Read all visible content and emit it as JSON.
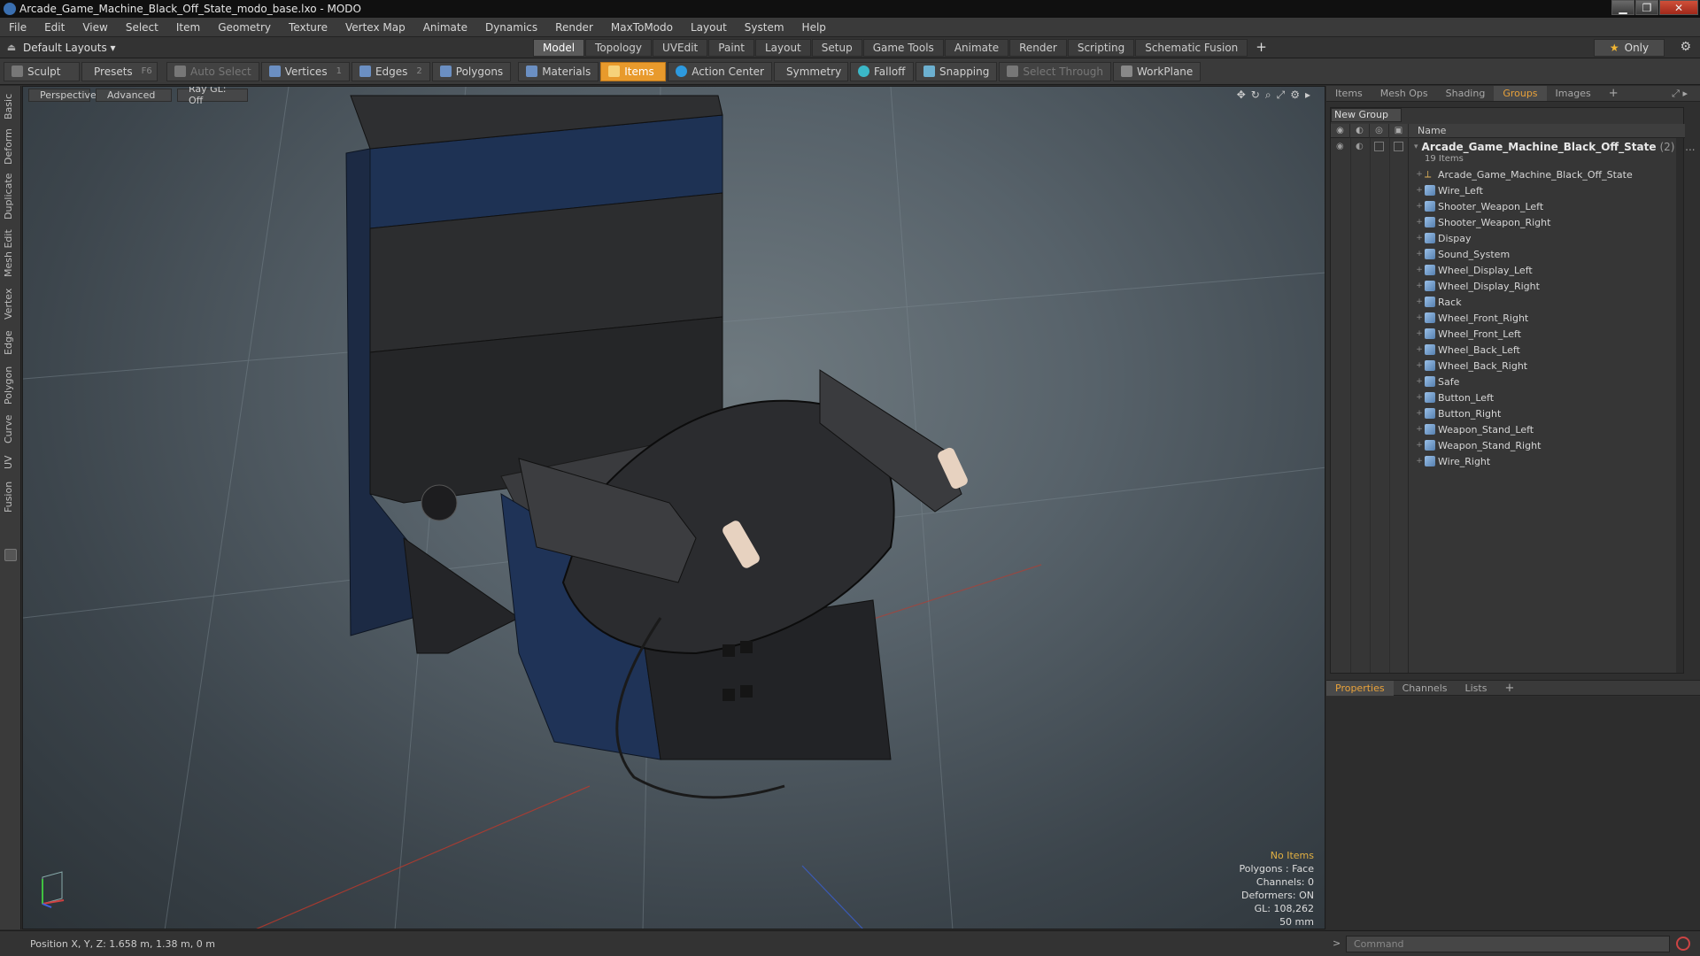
{
  "window": {
    "title": "Arcade_Game_Machine_Black_Off_State_modo_base.lxo - MODO",
    "minimize": "▁",
    "restore": "❐",
    "close": "✕"
  },
  "menu": [
    "File",
    "Edit",
    "View",
    "Select",
    "Item",
    "Geometry",
    "Texture",
    "Vertex Map",
    "Animate",
    "Dynamics",
    "Render",
    "MaxToModo",
    "Layout",
    "System",
    "Help"
  ],
  "layoutbar": {
    "layouts_label": "Default Layouts ▾",
    "tabs": [
      "Model",
      "Topology",
      "UVEdit",
      "Paint",
      "Layout",
      "Setup",
      "Game Tools",
      "Animate",
      "Render",
      "Scripting",
      "Schematic Fusion"
    ],
    "active_tab": "Model",
    "plus": "+",
    "only_label": "Only"
  },
  "toolbar": {
    "sculpt": "Sculpt",
    "presets": "Presets",
    "presets_key": "F6",
    "auto_select": "Auto Select",
    "vertices": "Vertices",
    "vertices_key": "1",
    "edges": "Edges",
    "edges_key": "2",
    "polygons": "Polygons",
    "materials": "Materials",
    "items": "Items",
    "action_center": "Action Center",
    "symmetry": "Symmetry",
    "falloff": "Falloff",
    "snapping": "Snapping",
    "select_through": "Select Through",
    "workplane": "WorkPlane"
  },
  "left_tabs": [
    "Basic",
    "Deform",
    "Duplicate",
    "Mesh Edit",
    "Vertex",
    "Edge",
    "Polygon",
    "Curve",
    "UV",
    "Fusion"
  ],
  "viewport": {
    "view": "Perspective",
    "shading": "Advanced",
    "raygl": "Ray GL: Off",
    "info": {
      "selection": "No Items",
      "polygons": "Polygons : Face",
      "channels": "Channels: 0",
      "deformers": "Deformers: ON",
      "gl": "GL: 108,262",
      "scale": "50 mm"
    }
  },
  "right_panel": {
    "tabs": [
      "Items",
      "Mesh Ops",
      "Shading",
      "Groups",
      "Images"
    ],
    "active_tab": "Groups",
    "new_group": "New Group",
    "column_name": "Name",
    "root": {
      "name": "Arcade_Game_Machine_Black_Off_State",
      "count": "(2) : ...",
      "sub": "19 Items"
    },
    "items": [
      {
        "name": "Arcade_Game_Machine_Black_Off_State",
        "icon": "locator-icon"
      },
      {
        "name": "Wire_Left",
        "icon": "mesh-icon"
      },
      {
        "name": "Shooter_Weapon_Left",
        "icon": "mesh-icon"
      },
      {
        "name": "Shooter_Weapon_Right",
        "icon": "mesh-icon"
      },
      {
        "name": "Dispay",
        "icon": "mesh-icon"
      },
      {
        "name": "Sound_System",
        "icon": "mesh-icon"
      },
      {
        "name": "Wheel_Display_Left",
        "icon": "mesh-icon"
      },
      {
        "name": "Wheel_Display_Right",
        "icon": "mesh-icon"
      },
      {
        "name": "Rack",
        "icon": "mesh-icon"
      },
      {
        "name": "Wheel_Front_Right",
        "icon": "mesh-icon"
      },
      {
        "name": "Wheel_Front_Left",
        "icon": "mesh-icon"
      },
      {
        "name": "Wheel_Back_Left",
        "icon": "mesh-icon"
      },
      {
        "name": "Wheel_Back_Right",
        "icon": "mesh-icon"
      },
      {
        "name": "Safe",
        "icon": "mesh-icon"
      },
      {
        "name": "Button_Left",
        "icon": "mesh-icon"
      },
      {
        "name": "Button_Right",
        "icon": "mesh-icon"
      },
      {
        "name": "Weapon_Stand_Left",
        "icon": "mesh-icon"
      },
      {
        "name": "Weapon_Stand_Right",
        "icon": "mesh-icon"
      },
      {
        "name": "Wire_Right",
        "icon": "mesh-icon"
      }
    ],
    "props_tabs": [
      "Properties",
      "Channels",
      "Lists"
    ],
    "props_active": "Properties"
  },
  "statusbar": {
    "position": "Position X, Y, Z:  1.658 m, 1.38 m, 0 m",
    "command_placeholder": "Command"
  },
  "colors": {
    "accent": "#e9a23a",
    "active_tool": "#e89a2c"
  }
}
